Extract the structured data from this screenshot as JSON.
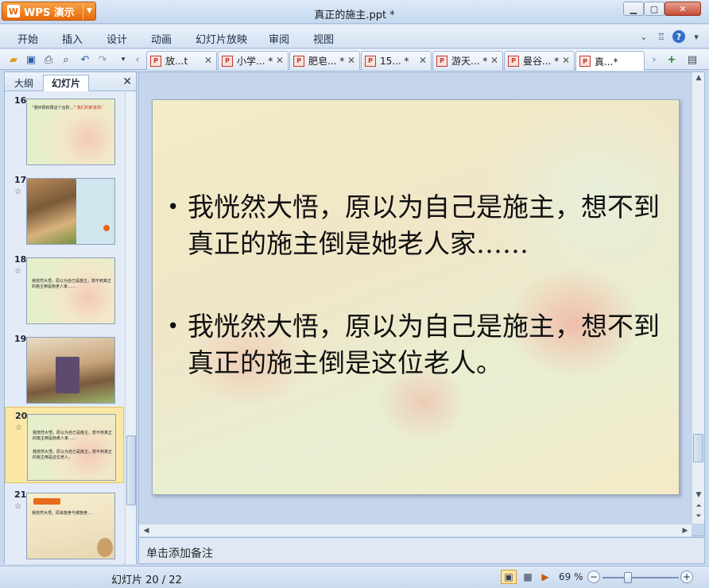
{
  "app": {
    "menu_label": "WPS 演示",
    "window_title": "真正的施主.ppt *"
  },
  "menubar": {
    "items": [
      "开始",
      "插入",
      "设计",
      "动画",
      "幻灯片放映",
      "审阅",
      "视图"
    ]
  },
  "tabs": [
    {
      "label": "放...t",
      "active": false
    },
    {
      "label": "小学... *",
      "active": false
    },
    {
      "label": "肥皂... *",
      "active": false
    },
    {
      "label": "15... *",
      "active": false
    },
    {
      "label": "游天... *",
      "active": false
    },
    {
      "label": "曼谷... *",
      "active": false
    },
    {
      "label": "真...*",
      "active": true
    }
  ],
  "left_panel": {
    "tab_outline": "大纲",
    "tab_slides": "幻灯片",
    "thumbnails": [
      {
        "num": "16",
        "star": false,
        "text": "“我环顾四周这个台阶…”",
        "highlight": "我们的新发现！"
      },
      {
        "num": "17",
        "star": true,
        "text": ""
      },
      {
        "num": "18",
        "star": true,
        "text": "我恍然大悟，原以为自己是施主，想不到真正的施主倒是她老人家……"
      },
      {
        "num": "19",
        "star": false,
        "text": ""
      },
      {
        "num": "20",
        "star": true,
        "text": "我恍然大悟，原以为自己是施主，想不到真正的施主倒是她老人家……",
        "text2": "我恍然大悟，原以为自己是施主，想不到真正的施主倒是这位老人。",
        "selected": true
      },
      {
        "num": "21",
        "star": true,
        "text": "我恍然大悟，原来施舍与被施舍…"
      }
    ]
  },
  "slide": {
    "bullets": [
      "我恍然大悟，原以为自己是施主，想不到真正的施主倒是她老人家……",
      "我恍然大悟，原以为自己是施主，想不到真正的施主倒是这位老人。"
    ]
  },
  "notes": {
    "placeholder": "单击添加备注"
  },
  "status": {
    "slide_count": "幻灯片 20 / 22",
    "zoom": "69 %"
  },
  "colors": {
    "accent_orange": "#e66a0b",
    "selection": "#fbe8a6",
    "chrome_blue": "#c9d9ee"
  }
}
